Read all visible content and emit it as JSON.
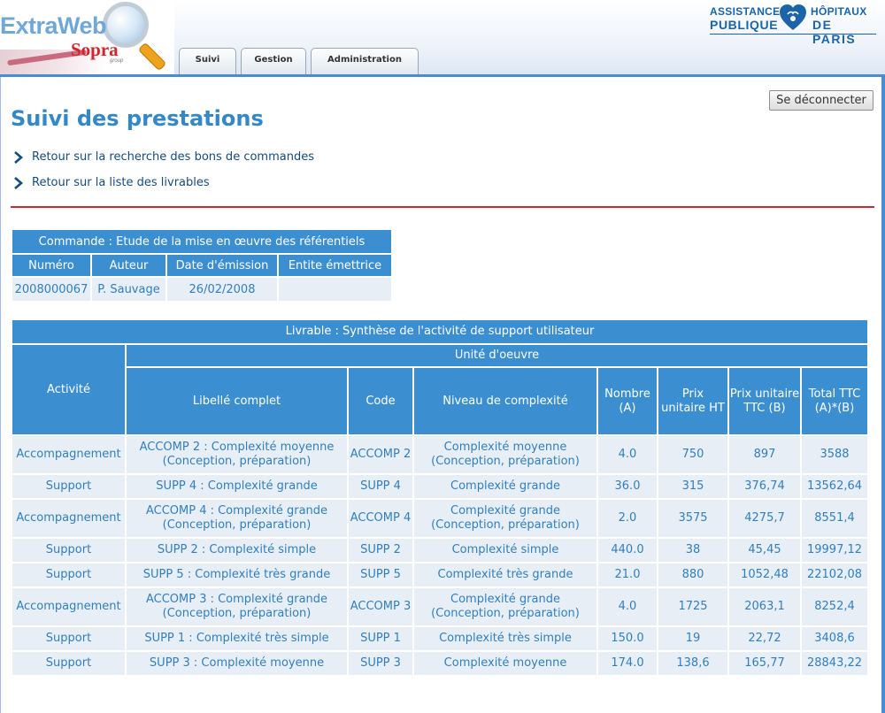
{
  "header": {
    "logo": {
      "brand": "ExtraWeb",
      "company": "Sopra",
      "company_suffix": "group"
    },
    "partner_logo": {
      "left_line1": "ASSISTANCE",
      "left_line2": "PUBLIQUE",
      "right_line1": "HÔPITAUX",
      "right_line2": "DE PARIS"
    },
    "tabs": [
      {
        "label": "Suivi"
      },
      {
        "label": "Gestion"
      },
      {
        "label": "Administration"
      }
    ]
  },
  "logout_label": "Se déconnecter",
  "page_title": "Suivi des prestations",
  "links": [
    {
      "label": "Retour sur la recherche des bons de commandes"
    },
    {
      "label": "Retour sur la liste des livrables"
    }
  ],
  "commande": {
    "caption": "Commande : Etude de la mise en œuvre des référentiels",
    "headers": [
      "Numéro",
      "Auteur",
      "Date d'émission",
      "Entite émettrice"
    ],
    "row": [
      "2008000067",
      "P. Sauvage",
      "26/02/2008",
      ""
    ]
  },
  "livrable": {
    "caption": "Livrable : Synthèse de l'activité de support utilisateur",
    "activite_header": "Activité",
    "group_header": "Unité d'oeuvre",
    "columns": [
      "Libellé complet",
      "Code",
      "Niveau de complexité",
      "Nombre (A)",
      "Prix unitaire HT",
      "Prix unitaire TTC (B)",
      "Total TTC (A)*(B)"
    ],
    "rows": [
      [
        "Accompagnement",
        "ACCOMP 2 : Complexité moyenne (Conception, préparation)",
        "ACCOMP 2",
        "Complexité moyenne (Conception, préparation)",
        "4.0",
        "750",
        "897",
        "3588"
      ],
      [
        "Support",
        "SUPP 4 : Complexité grande",
        "SUPP 4",
        "Complexité grande",
        "36.0",
        "315",
        "376,74",
        "13562,64"
      ],
      [
        "Accompagnement",
        "ACCOMP 4 : Complexité grande (Conception, préparation)",
        "ACCOMP 4",
        "Complexité grande (Conception, préparation)",
        "2.0",
        "3575",
        "4275,7",
        "8551,4"
      ],
      [
        "Support",
        "SUPP 2 : Complexité simple",
        "SUPP 2",
        "Complexité simple",
        "440.0",
        "38",
        "45,45",
        "19997,12"
      ],
      [
        "Support",
        "SUPP 5 : Complexité très grande",
        "SUPP 5",
        "Complexité très grande",
        "21.0",
        "880",
        "1052,48",
        "22102,08"
      ],
      [
        "Accompagnement",
        "ACCOMP 3 : Complexité grande (Conception, préparation)",
        "ACCOMP 3",
        "Complexité grande (Conception, préparation)",
        "4.0",
        "1725",
        "2063,1",
        "8252,4"
      ],
      [
        "Support",
        "SUPP 1 : Complexité très simple",
        "SUPP 1",
        "Complexité très simple",
        "150.0",
        "19",
        "22,72",
        "3408,6"
      ],
      [
        "Support",
        "SUPP 3 : Complexité moyenne",
        "SUPP 3",
        "Complexité moyenne",
        "174.0",
        "138,6",
        "165,77",
        "28843,22"
      ]
    ]
  }
}
